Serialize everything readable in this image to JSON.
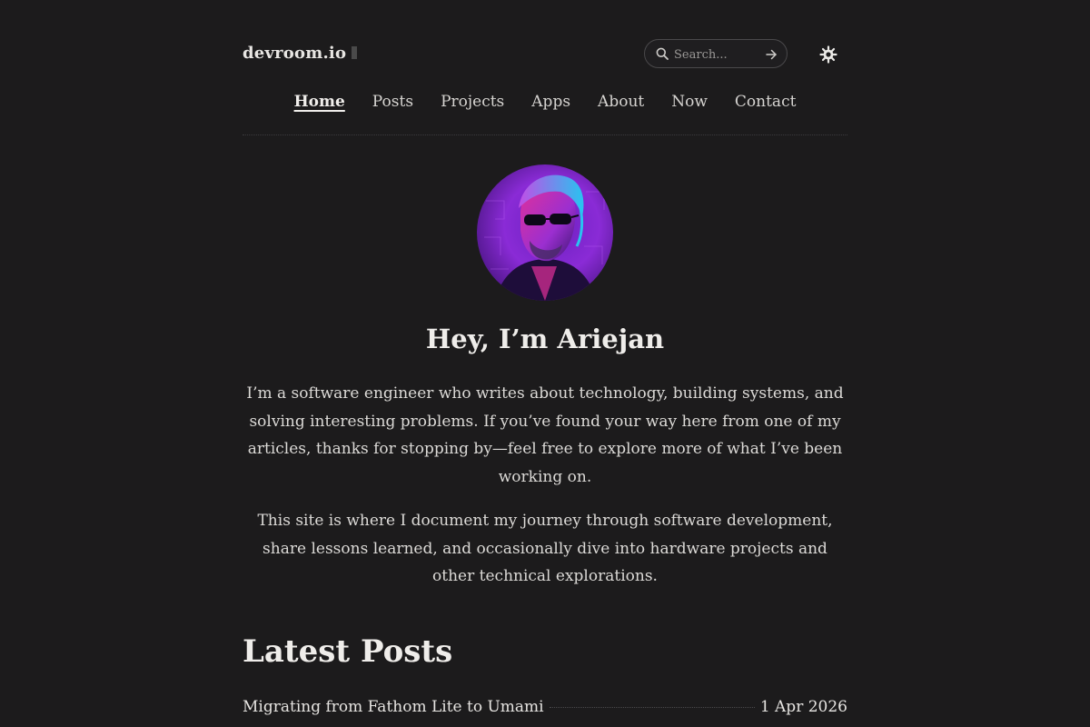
{
  "header": {
    "site_title": "devroom.io",
    "search": {
      "placeholder": "Search..."
    }
  },
  "nav": {
    "items": [
      {
        "label": "Home",
        "active": true
      },
      {
        "label": "Posts"
      },
      {
        "label": "Projects"
      },
      {
        "label": "Apps"
      },
      {
        "label": "About"
      },
      {
        "label": "Now"
      },
      {
        "label": "Contact"
      }
    ]
  },
  "hero": {
    "title": "Hey, I’m Ariejan",
    "paragraphs": [
      "I’m a software engineer who writes about technology, building systems, and solving interesting problems. If you’ve found your way here from one of my articles, thanks for stopping by—feel free to explore more of what I’ve been working on.",
      "This site is where I document my journey through software development, share lessons learned, and occasionally dive into hardware projects and other technical explorations."
    ]
  },
  "latest_posts": {
    "title": "Latest Posts",
    "items": [
      {
        "title": "Migrating from Fathom Lite to Umami",
        "date": "1 Apr 2026"
      }
    ]
  },
  "colors": {
    "background": "#1c1b1c",
    "text": "#e6e4e2",
    "avatar_purple": "#8a2bd6",
    "avatar_pink": "#e0309a",
    "avatar_cyan": "#29c3f0"
  },
  "icons": [
    "search-icon",
    "arrow-right-icon",
    "sun-icon"
  ]
}
